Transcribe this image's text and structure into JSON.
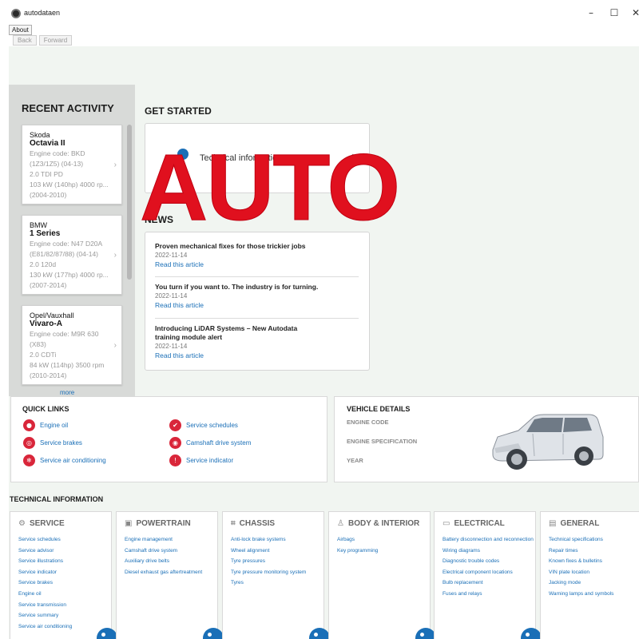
{
  "window": {
    "title": "autodataen",
    "minimize": "–",
    "maximize": "☐",
    "close": "✕"
  },
  "menu": {
    "about": "About"
  },
  "nav": {
    "back": "Back",
    "forward": "Forward"
  },
  "watermark": "AUTO",
  "recent_activity": {
    "title": "RECENT ACTIVITY",
    "cards": [
      {
        "make": "Skoda",
        "model": "Octavia II",
        "lines": [
          "Engine code: BKD",
          "(1Z3/1Z5) (04-13)",
          "2.0 TDI PD",
          "103 kW (140hp) 4000 rp...",
          "(2004-2010)"
        ]
      },
      {
        "make": "BMW",
        "model": "1 Series",
        "lines": [
          "Engine code: N47 D20A",
          "(E81/82/87/88) (04-14)",
          "2.0 120d",
          "130 kW (177hp) 4000 rp...",
          "(2007-2014)"
        ]
      },
      {
        "make": "Opel/Vauxhall",
        "model": "Vivaro-A",
        "lines": [
          "Engine code: M9R 630",
          "(X83)",
          "2.0 CDTi",
          "84 kW (114hp) 3500 rpm",
          "(2010-2014)"
        ]
      }
    ],
    "more": "more"
  },
  "get_started": {
    "title": "GET STARTED",
    "card_label": "Technical information"
  },
  "news": {
    "title": "NEWS",
    "items": [
      {
        "title": "Proven mechanical fixes for those trickier jobs",
        "date": "2022-11-14",
        "link": "Read this article"
      },
      {
        "title": "You turn if you want to. The industry is for turning.",
        "date": "2022-11-14",
        "link": "Read this article"
      },
      {
        "title": "Introducing LiDAR Systems – New Autodata training module alert",
        "date": "2022-11-14",
        "link": "Read this article"
      }
    ]
  },
  "quick_links": {
    "title": "QUICK LINKS",
    "items": [
      {
        "label": "Engine oil",
        "icon": "oil-drop-icon",
        "glyph": "●"
      },
      {
        "label": "Service brakes",
        "icon": "brake-icon",
        "glyph": "◎"
      },
      {
        "label": "Service air conditioning",
        "icon": "snowflake-icon",
        "glyph": "❄"
      },
      {
        "label": "Service schedules",
        "icon": "check-icon",
        "glyph": "✔"
      },
      {
        "label": "Camshaft drive system",
        "icon": "camshaft-icon",
        "glyph": "◉"
      },
      {
        "label": "Service indicator",
        "icon": "warning-icon",
        "glyph": "!"
      }
    ]
  },
  "vehicle_details": {
    "title": "VEHICLE DETAILS",
    "fields": [
      "ENGINE CODE",
      "ENGINE SPECIFICATION",
      "YEAR"
    ]
  },
  "technical_information": {
    "title": "TECHNICAL INFORMATION",
    "categories": [
      {
        "name": "SERVICE",
        "icon": "service-icon",
        "glyph": "⚙",
        "links": [
          "Service schedules",
          "Service advisor",
          "Service illustrations",
          "Service indicator",
          "Service brakes",
          "Engine oil",
          "Service transmission",
          "Service summary",
          "Service air conditioning"
        ]
      },
      {
        "name": "POWERTRAIN",
        "icon": "engine-icon",
        "glyph": "▣",
        "links": [
          "Engine management",
          "Camshaft drive system",
          "Auxiliary drive belts",
          "Diesel exhaust gas aftertreatment"
        ]
      },
      {
        "name": "CHASSIS",
        "icon": "chassis-icon",
        "glyph": "⌗",
        "links": [
          "Anti-lock brake systems",
          "Wheel alignment",
          "Tyre pressures",
          "Tyre pressure monitoring system",
          "Tyres"
        ]
      },
      {
        "name": "BODY & INTERIOR",
        "icon": "seat-icon",
        "glyph": "♙",
        "links": [
          "Airbags",
          "Key programming"
        ]
      },
      {
        "name": "ELECTRICAL",
        "icon": "battery-icon",
        "glyph": "▭",
        "links": [
          "Battery disconnection and reconnection",
          "Wiring diagrams",
          "Diagnostic trouble codes",
          "Electrical component locations",
          "Bulb replacement",
          "Fuses and relays"
        ]
      },
      {
        "name": "GENERAL",
        "icon": "document-icon",
        "glyph": "▤",
        "links": [
          "Technical specifications",
          "Repair times",
          "Known fixes & bulletins",
          "VIN plate location",
          "Jacking mode",
          "Warning lamps and symbols"
        ]
      }
    ]
  },
  "colors": {
    "accent": "#1a6fb7",
    "quick_link_icon": "#d9263a",
    "watermark": "#e0101e",
    "sidebar": "#d8dad8",
    "content_bg": "#f1f5f1"
  }
}
